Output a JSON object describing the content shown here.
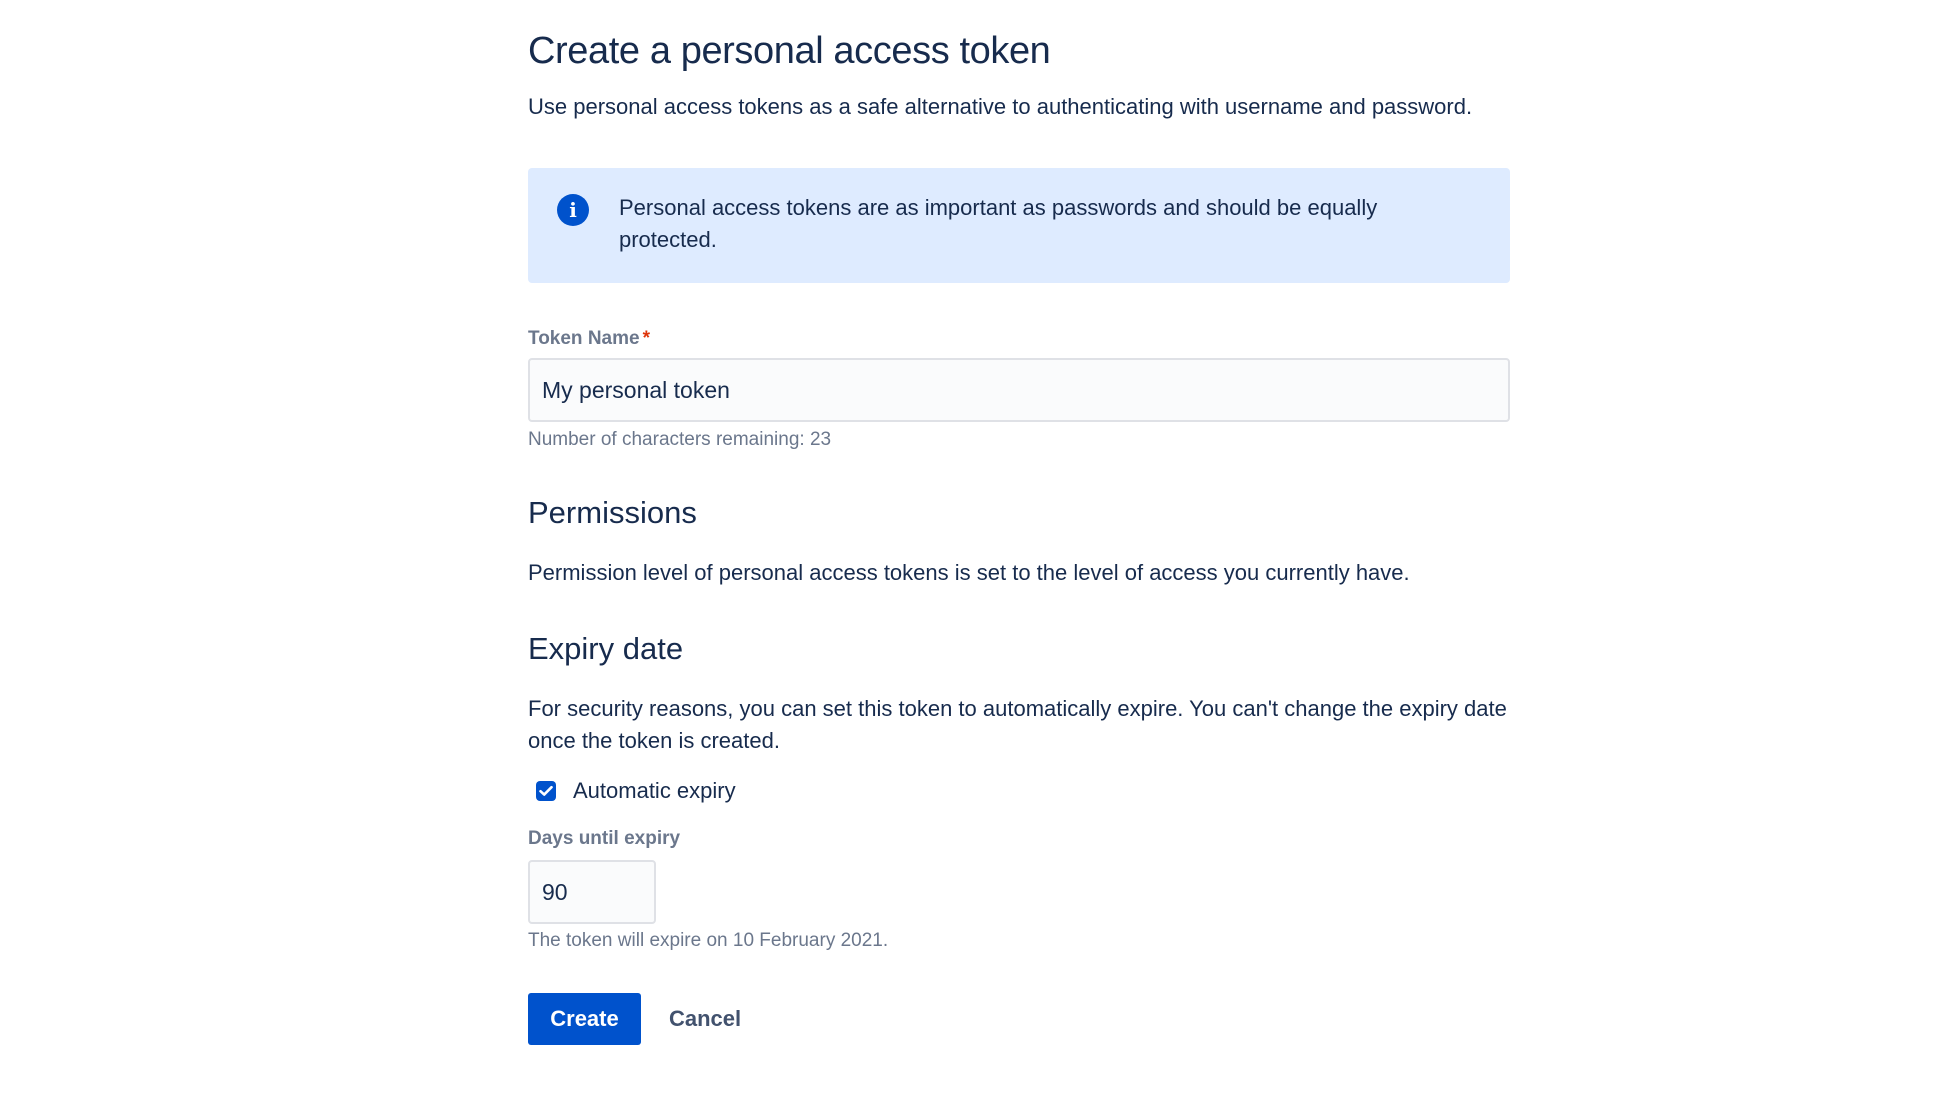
{
  "header": {
    "title": "Create a personal access token",
    "description": "Use personal access tokens as a safe alternative to authenticating with username and password."
  },
  "info_banner": {
    "icon": "info-icon",
    "icon_glyph": "i",
    "text": "Personal access tokens are as important as passwords and should be equally protected."
  },
  "token_name": {
    "label": "Token Name",
    "required_mark": "*",
    "value": "My personal token",
    "helper": "Number of characters remaining: 23"
  },
  "permissions": {
    "heading": "Permissions",
    "text": "Permission level of personal access tokens is set to the level of access you currently have."
  },
  "expiry": {
    "heading": "Expiry date",
    "text": "For security reasons, you can set this token to automatically expire. You can't change the expiry date once the token is created.",
    "automatic_label": "Automatic expiry",
    "automatic_checked": true,
    "days_label": "Days until expiry",
    "days_value": "90",
    "helper": "The token will expire on 10 February 2021."
  },
  "actions": {
    "create_label": "Create",
    "cancel_label": "Cancel"
  },
  "colors": {
    "primary": "#0052cc",
    "info_background": "#deebff",
    "text": "#172b4d",
    "subtle_text": "#6b778c",
    "required": "#de350b"
  }
}
